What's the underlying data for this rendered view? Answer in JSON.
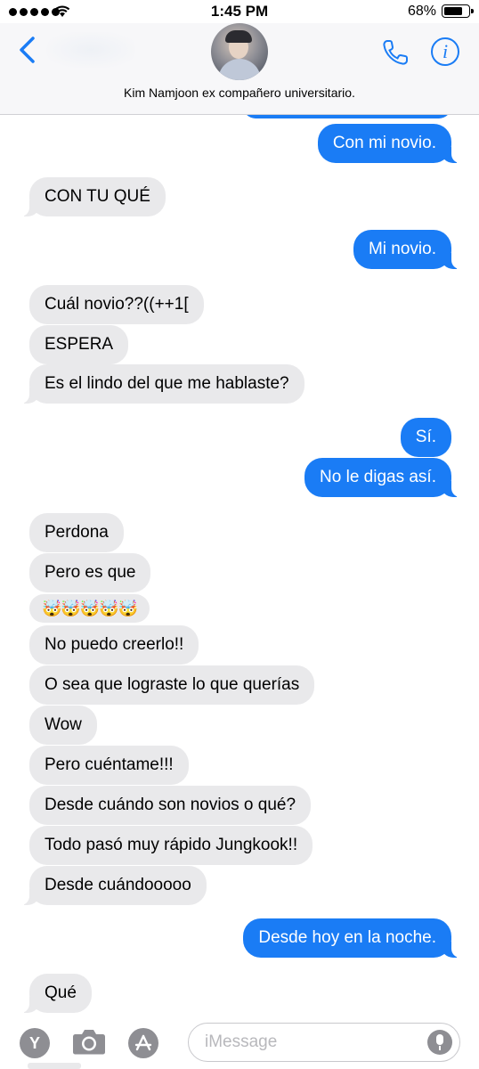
{
  "status_bar": {
    "time": "1:45 PM",
    "battery_percent": "68%",
    "battery_level": 0.68,
    "signal_bars": 5
  },
  "header": {
    "contact_name": "Kim Namjoon ex compañero universitario.",
    "back_icon": "chevron-left-icon",
    "call_icon": "phone-icon",
    "info_icon": "info-icon",
    "info_glyph": "i",
    "accent_color": "#1a7cf5"
  },
  "messages": [
    {
      "from": "me",
      "text": "Con mi novio."
    },
    {
      "from": "them",
      "text": "CON TU QUÉ"
    },
    {
      "from": "me",
      "text": "Mi novio."
    },
    {
      "from": "them",
      "text": "Cuál novio??((++1["
    },
    {
      "from": "them",
      "text": "ESPERA"
    },
    {
      "from": "them",
      "text": "Es el lindo del que me hablaste?"
    },
    {
      "from": "me",
      "text": "Sí."
    },
    {
      "from": "me",
      "text": "No le digas así."
    },
    {
      "from": "them",
      "text": "Perdona"
    },
    {
      "from": "them",
      "text": "Pero es que"
    },
    {
      "from": "them",
      "text": "🤯🤯🤯🤯🤯"
    },
    {
      "from": "them",
      "text": "No puedo creerlo!!"
    },
    {
      "from": "them",
      "text": "O sea que lograste lo que querías"
    },
    {
      "from": "them",
      "text": "Wow"
    },
    {
      "from": "them",
      "text": "Pero cuéntame!!!"
    },
    {
      "from": "them",
      "text": "Desde cuándo son novios o qué?"
    },
    {
      "from": "them",
      "text": "Todo pasó muy rápido Jungkook!!"
    },
    {
      "from": "them",
      "text": "Desde cuándooooo"
    },
    {
      "from": "me",
      "text": "Desde hoy en la noche."
    },
    {
      "from": "them",
      "text": "Qué"
    }
  ],
  "input_bar": {
    "placeholder": "iMessage",
    "value": "",
    "app_icon_letter": "Y",
    "icons": [
      "y-app-icon",
      "camera-icon",
      "app-store-icon",
      "microphone-icon"
    ]
  },
  "colors": {
    "outgoing_bubble": "#1a7cf5",
    "incoming_bubble": "#e9e9eb"
  }
}
